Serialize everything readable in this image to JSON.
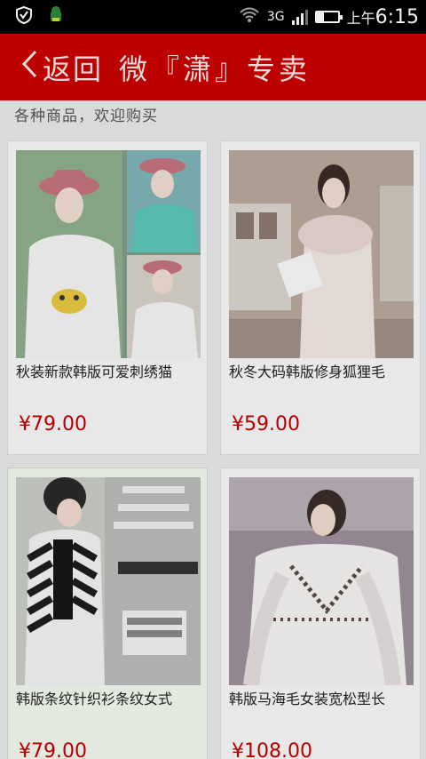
{
  "status_bar": {
    "network": "3G",
    "ampm": "上午",
    "time": "6:15"
  },
  "header": {
    "back_label": "返回",
    "title": "微『潇』专卖"
  },
  "subtitle": "各种商品，欢迎购买",
  "products": [
    {
      "name": "秋装新款韩版可爱刺绣猫",
      "price": "¥79.00",
      "image": "sweater-hat-model-photo"
    },
    {
      "name": "秋冬大码韩版修身狐狸毛",
      "price": "¥59.00",
      "image": "fur-collar-coat-photo"
    },
    {
      "name": "韩版条纹针织衫条纹女式",
      "price": "¥79.00",
      "image": "striped-cardigan-photo"
    },
    {
      "name": "韩版马海毛女装宽松型长",
      "price": "¥108.00",
      "image": "mohair-sweater-photo"
    }
  ],
  "colors": {
    "header_bg": "#c80000",
    "price": "#c00000"
  }
}
